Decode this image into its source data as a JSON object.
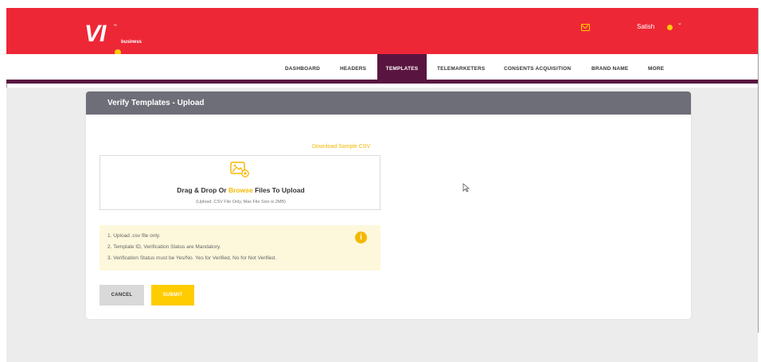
{
  "brand": {
    "logo_text": "VI",
    "logo_subtext": "business",
    "logo_tm": "™",
    "red": "#ee2737",
    "yellow": "#ffcc00",
    "purple": "#5a1440"
  },
  "header": {
    "mail_icon": "mail-icon",
    "user_name": "Satish",
    "user_caret": "⌄"
  },
  "nav": {
    "items": [
      {
        "label": "DASHBOARD",
        "active": false
      },
      {
        "label": "HEADERS",
        "active": false
      },
      {
        "label": "TEMPLATES",
        "active": true
      },
      {
        "label": "TELEMARKETERS",
        "active": false
      },
      {
        "label": "CONSENTS ACQUISITION",
        "active": false
      },
      {
        "label": "BRAND NAME",
        "active": false
      },
      {
        "label": "MORE",
        "active": false
      }
    ]
  },
  "card": {
    "title": "Verify Templates - Upload",
    "download_link": "Download Sample CSV",
    "upload": {
      "icon": "image-upload-icon",
      "text_before": "Drag & Drop Or ",
      "browse_label": "Browse",
      "text_after": " Files To Upload",
      "hint": "(Upload .CSV File Only, Max File Size is 2MB)"
    },
    "info": {
      "lines": [
        "1. Upload .csv file only.",
        "2. Template ID, Verification Status are Mandatory.",
        "3. Verification Status must be Yes/No. Yes for Verified, No for Not Verified."
      ],
      "icon": "info-icon",
      "icon_glyph": "i"
    },
    "buttons": {
      "cancel_label": "CANCEL",
      "submit_label": "SUBMIT"
    }
  }
}
